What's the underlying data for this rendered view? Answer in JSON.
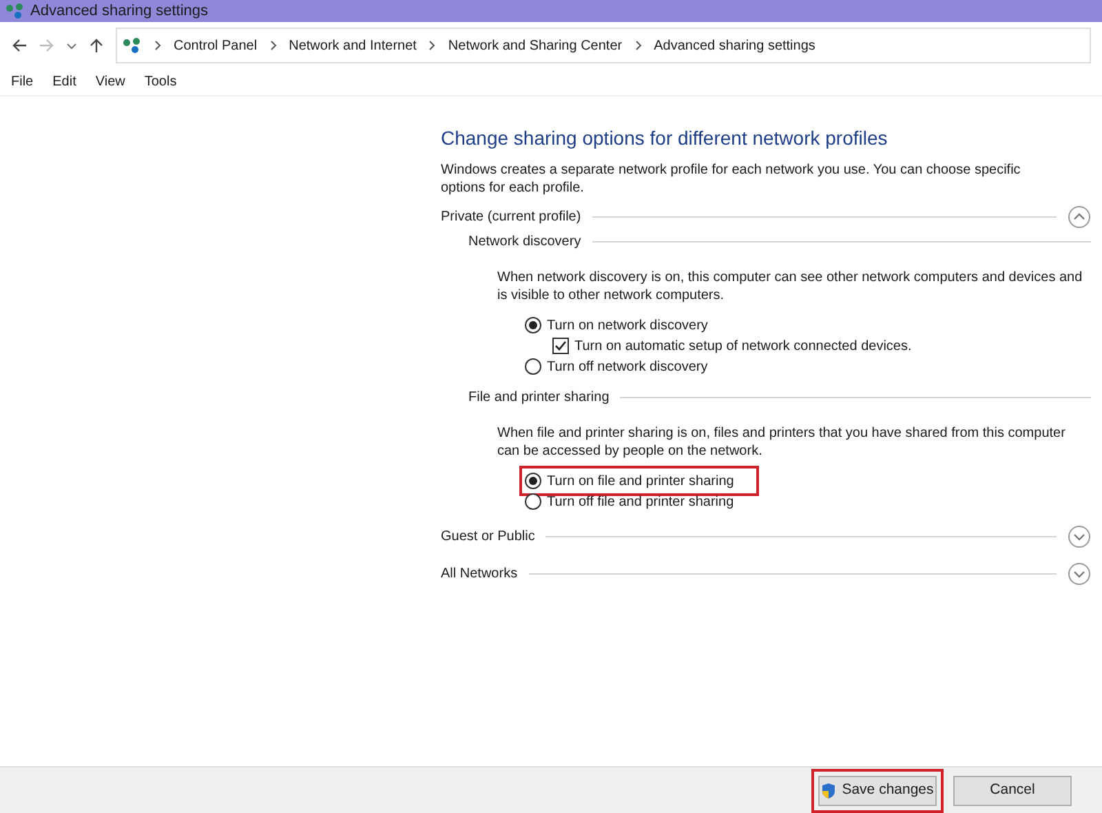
{
  "window": {
    "title": "Advanced sharing settings"
  },
  "breadcrumb": [
    "Control Panel",
    "Network and Internet",
    "Network and Sharing Center",
    "Advanced sharing settings"
  ],
  "menu": [
    "File",
    "Edit",
    "View",
    "Tools"
  ],
  "heading": "Change sharing options for different network profiles",
  "intro": "Windows creates a separate network profile for each network you use. You can choose specific options for each profile.",
  "sections": [
    {
      "title": "Private (current profile)",
      "expanded": true,
      "groups": [
        {
          "title": "Network discovery",
          "description": "When network discovery is on, this computer can see other network computers and devices and is visible to other network computers.",
          "options": [
            {
              "kind": "radio",
              "label": "Turn on network discovery",
              "selected": true,
              "highlighted": false
            },
            {
              "kind": "checkbox",
              "label": "Turn on automatic setup of network connected devices.",
              "checked": true
            },
            {
              "kind": "radio",
              "label": "Turn off network discovery",
              "selected": false,
              "highlighted": false
            }
          ]
        },
        {
          "title": "File and printer sharing",
          "description": "When file and printer sharing is on, files and printers that you have shared from this computer can be accessed by people on the network.",
          "options": [
            {
              "kind": "radio",
              "label": "Turn on file and printer sharing",
              "selected": true,
              "highlighted": true
            },
            {
              "kind": "radio",
              "label": "Turn off file and printer sharing",
              "selected": false,
              "highlighted": false
            }
          ]
        }
      ]
    },
    {
      "title": "Guest or Public",
      "expanded": false
    },
    {
      "title": "All Networks",
      "expanded": false
    }
  ],
  "buttons": [
    {
      "label": "Save changes",
      "shield": true,
      "highlighted": true
    },
    {
      "label": "Cancel",
      "shield": false,
      "highlighted": false
    }
  ]
}
